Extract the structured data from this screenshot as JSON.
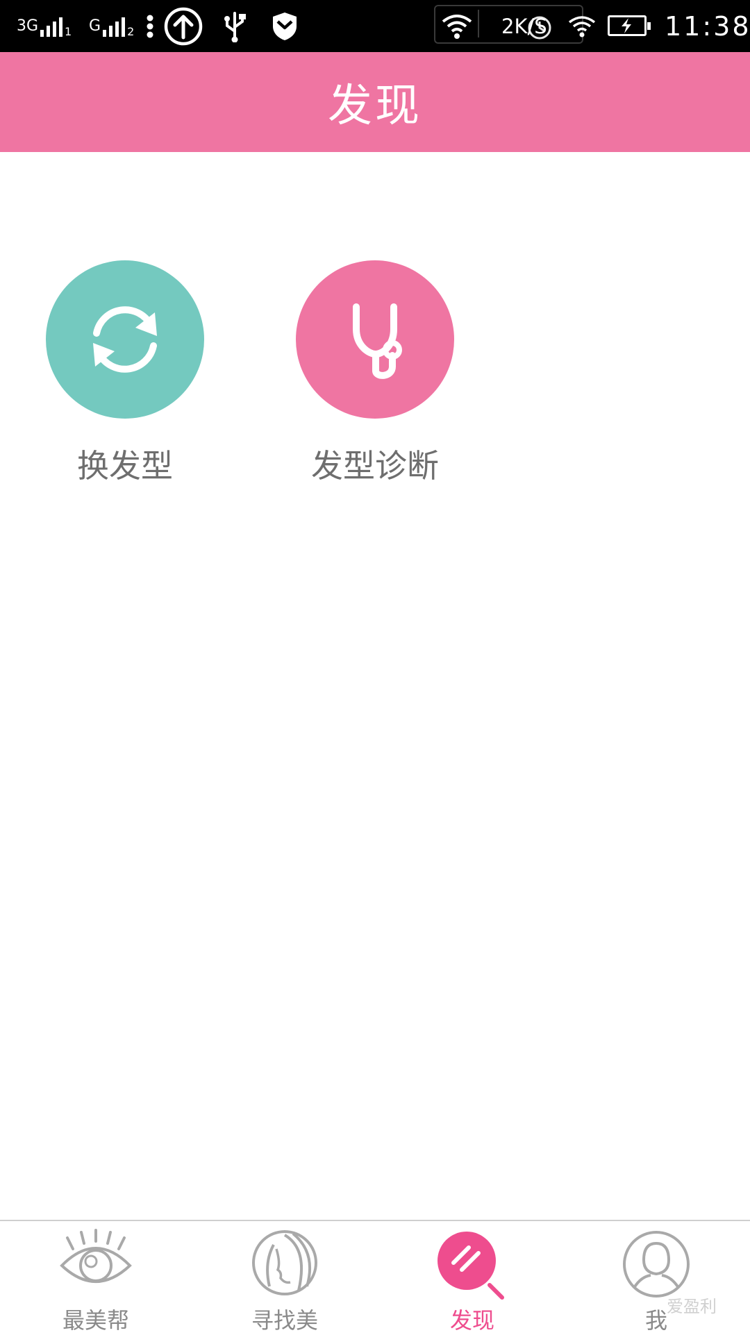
{
  "status_bar": {
    "network_1": "3G",
    "sim_1": "1",
    "network_2": "G",
    "sim_2": "2",
    "speed": "2K/S",
    "time": "11:38"
  },
  "header": {
    "title": "发现"
  },
  "features": [
    {
      "label": "换发型",
      "icon": "refresh-icon",
      "color": "#74c9bf"
    },
    {
      "label": "发型诊断",
      "icon": "stethoscope-icon",
      "color": "#ef75a2"
    }
  ],
  "nav": {
    "items": [
      {
        "label": "最美帮",
        "icon": "eye-icon"
      },
      {
        "label": "寻找美",
        "icon": "hair-profile-icon"
      },
      {
        "label": "发现",
        "icon": "mirror-icon",
        "active": true
      },
      {
        "label": "我",
        "icon": "user-icon"
      }
    ]
  },
  "watermark": "爱盈利",
  "colors": {
    "accent": "#ef75a2",
    "active_nav": "#ee4d8e",
    "teal": "#74c9bf",
    "nav_inactive": "#8a8a8a"
  }
}
